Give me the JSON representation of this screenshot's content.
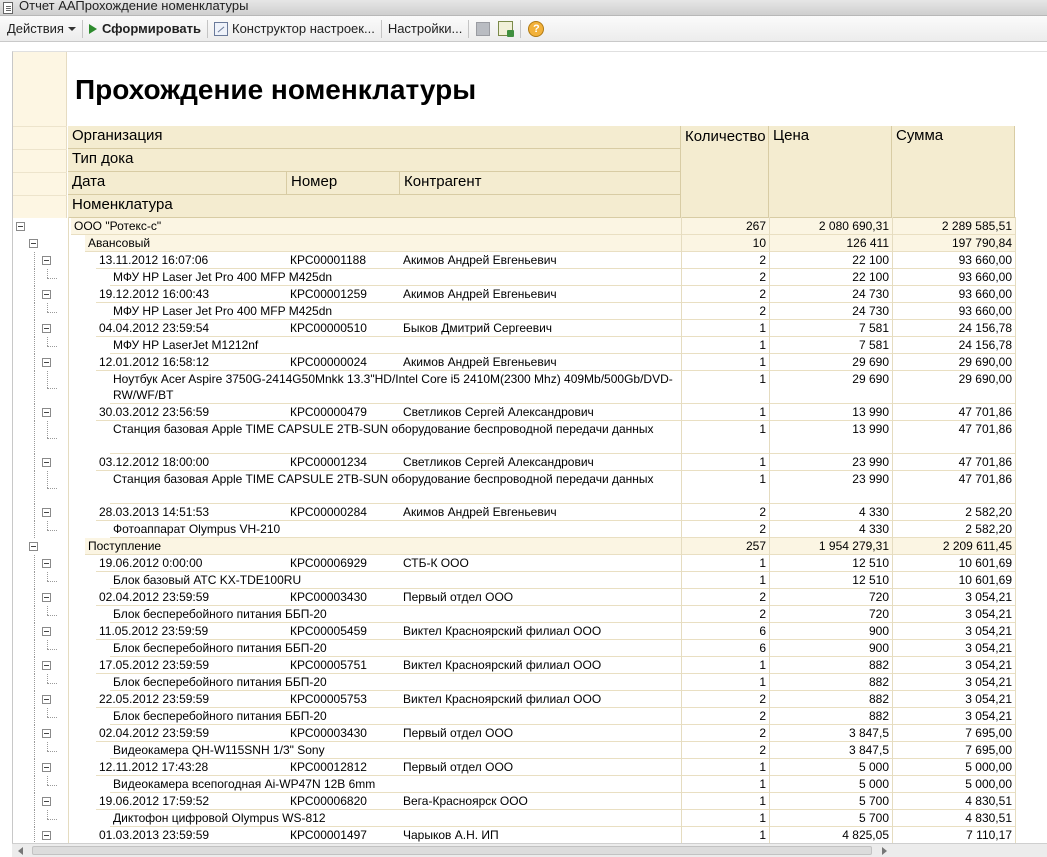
{
  "window": {
    "title": "Отчет  ААПрохождение номенклатуры"
  },
  "toolbar": {
    "actions_label": "Действия",
    "generate_label": "Сформировать",
    "constructor_label": "Конструктор настроек...",
    "settings_label": "Настройки...",
    "help_label": "?"
  },
  "report": {
    "title": "Прохождение номенклатуры",
    "headers": {
      "org": "Организация",
      "doc_type": "Тип дока",
      "date": "Дата",
      "number": "Номер",
      "counterparty": "Контрагент",
      "nomenclature": "Номенклатура",
      "quantity": "Количество",
      "price": "Цена",
      "sum": "Сумма"
    },
    "rows": [
      {
        "level": 0,
        "kind": "group",
        "text": "ООО \"Ротекс-с\"",
        "qty": "267",
        "price": "2 080 690,31",
        "sum": "2 289 585,51"
      },
      {
        "level": 1,
        "kind": "group",
        "text": "Авансовый",
        "qty": "10",
        "price": "126 411",
        "sum": "197 790,84"
      },
      {
        "level": 2,
        "kind": "doc",
        "date": "13.11.2012 16:07:06",
        "number": "КРС00001188",
        "counterparty": "Акимов Андрей Евгеньевич",
        "qty": "2",
        "price": "22 100",
        "sum": "93 660,00"
      },
      {
        "level": 3,
        "kind": "item",
        "text": "МФУ HP Laser Jet Pro 400 MFP M425dn",
        "qty": "2",
        "price": "22 100",
        "sum": "93 660,00"
      },
      {
        "level": 2,
        "kind": "doc",
        "date": "19.12.2012 16:00:43",
        "number": "КРС00001259",
        "counterparty": "Акимов Андрей Евгеньевич",
        "qty": "2",
        "price": "24 730",
        "sum": "93 660,00"
      },
      {
        "level": 3,
        "kind": "item",
        "text": "МФУ HP Laser Jet Pro 400 MFP M425dn",
        "qty": "2",
        "price": "24 730",
        "sum": "93 660,00"
      },
      {
        "level": 2,
        "kind": "doc",
        "date": "04.04.2012 23:59:54",
        "number": "КРС00000510",
        "counterparty": "Быков Дмитрий Сергеевич",
        "qty": "1",
        "price": "7 581",
        "sum": "24 156,78"
      },
      {
        "level": 3,
        "kind": "item",
        "text": "МФУ HP LaserJet M1212nf",
        "qty": "1",
        "price": "7 581",
        "sum": "24 156,78"
      },
      {
        "level": 2,
        "kind": "doc",
        "date": "12.01.2012 16:58:12",
        "number": "КРС00000024",
        "counterparty": "Акимов Андрей Евгеньевич",
        "qty": "1",
        "price": "29 690",
        "sum": "29 690,00"
      },
      {
        "level": 3,
        "kind": "item",
        "text": "Ноутбук Acer Aspire 3750G-2414G50Mnkk 13.3\"HD/Intel Core i5 2410M(2300 Mhz) 409Mb/500Gb/DVD-RW/WF/BT",
        "qty": "1",
        "price": "29 690",
        "sum": "29 690,00",
        "tall": true
      },
      {
        "level": 2,
        "kind": "doc",
        "date": "30.03.2012 23:56:59",
        "number": "КРС00000479",
        "counterparty": "Светликов Сергей Александрович",
        "qty": "1",
        "price": "13 990",
        "sum": "47 701,86"
      },
      {
        "level": 3,
        "kind": "item",
        "text": "Станция базовая Apple TIME CAPSULE 2TB-SUN оборудование беспроводной передачи данных",
        "qty": "1",
        "price": "13 990",
        "sum": "47 701,86",
        "tall": true
      },
      {
        "level": 2,
        "kind": "doc",
        "date": "03.12.2012 18:00:00",
        "number": "КРС00001234",
        "counterparty": "Светликов Сергей Александрович",
        "qty": "1",
        "price": "23 990",
        "sum": "47 701,86"
      },
      {
        "level": 3,
        "kind": "item",
        "text": "Станция базовая Apple TIME CAPSULE 2TB-SUN оборудование беспроводной передачи данных",
        "qty": "1",
        "price": "23 990",
        "sum": "47 701,86",
        "tall": true
      },
      {
        "level": 2,
        "kind": "doc",
        "date": "28.03.2013 14:51:53",
        "number": "КРС00000284",
        "counterparty": "Акимов Андрей Евгеньевич",
        "qty": "2",
        "price": "4 330",
        "sum": "2 582,20"
      },
      {
        "level": 3,
        "kind": "item",
        "text": "Фотоаппарат Olympus VH-210",
        "qty": "2",
        "price": "4 330",
        "sum": "2 582,20"
      },
      {
        "level": 1,
        "kind": "group",
        "text": "Поступление",
        "qty": "257",
        "price": "1 954 279,31",
        "sum": "2 209 611,45"
      },
      {
        "level": 2,
        "kind": "doc",
        "date": "19.06.2012 0:00:00",
        "number": "КРС00006929",
        "counterparty": "СТБ-К ООО",
        "qty": "1",
        "price": "12 510",
        "sum": "10 601,69"
      },
      {
        "level": 3,
        "kind": "item",
        "text": "Блок базовый АТС KX-TDE100RU",
        "qty": "1",
        "price": "12 510",
        "sum": "10 601,69"
      },
      {
        "level": 2,
        "kind": "doc",
        "date": "02.04.2012 23:59:59",
        "number": "КРС00003430",
        "counterparty": "Первый отдел ООО",
        "qty": "2",
        "price": "720",
        "sum": "3 054,21"
      },
      {
        "level": 3,
        "kind": "item",
        "text": "Блок бесперебойного питания ББП-20",
        "qty": "2",
        "price": "720",
        "sum": "3 054,21"
      },
      {
        "level": 2,
        "kind": "doc",
        "date": "11.05.2012 23:59:59",
        "number": "КРС00005459",
        "counterparty": "Виктел Красноярский филиал ООО",
        "qty": "6",
        "price": "900",
        "sum": "3 054,21"
      },
      {
        "level": 3,
        "kind": "item",
        "text": "Блок бесперебойного питания ББП-20",
        "qty": "6",
        "price": "900",
        "sum": "3 054,21"
      },
      {
        "level": 2,
        "kind": "doc",
        "date": "17.05.2012 23:59:59",
        "number": "КРС00005751",
        "counterparty": "Виктел Красноярский филиал ООО",
        "qty": "1",
        "price": "882",
        "sum": "3 054,21"
      },
      {
        "level": 3,
        "kind": "item",
        "text": "Блок бесперебойного питания ББП-20",
        "qty": "1",
        "price": "882",
        "sum": "3 054,21"
      },
      {
        "level": 2,
        "kind": "doc",
        "date": "22.05.2012 23:59:59",
        "number": "КРС00005753",
        "counterparty": "Виктел Красноярский филиал ООО",
        "qty": "2",
        "price": "882",
        "sum": "3 054,21"
      },
      {
        "level": 3,
        "kind": "item",
        "text": "Блок бесперебойного питания ББП-20",
        "qty": "2",
        "price": "882",
        "sum": "3 054,21"
      },
      {
        "level": 2,
        "kind": "doc",
        "date": "02.04.2012 23:59:59",
        "number": "КРС00003430",
        "counterparty": "Первый отдел ООО",
        "qty": "2",
        "price": "3 847,5",
        "sum": "7 695,00"
      },
      {
        "level": 3,
        "kind": "item",
        "text": "Видеокамера QH-W115SNH 1/3\" Sony",
        "qty": "2",
        "price": "3 847,5",
        "sum": "7 695,00"
      },
      {
        "level": 2,
        "kind": "doc",
        "date": "12.11.2012 17:43:28",
        "number": "КРС00012812",
        "counterparty": "Первый отдел ООО",
        "qty": "1",
        "price": "5 000",
        "sum": "5 000,00"
      },
      {
        "level": 3,
        "kind": "item",
        "text": "Видеокамера всепогодная Ai-WP47N 12В 6mm",
        "qty": "1",
        "price": "5 000",
        "sum": "5 000,00"
      },
      {
        "level": 2,
        "kind": "doc",
        "date": "19.06.2012 17:59:52",
        "number": "КРС00006820",
        "counterparty": "Вега-Красноярск ООО",
        "qty": "1",
        "price": "5 700",
        "sum": "4 830,51"
      },
      {
        "level": 3,
        "kind": "item",
        "text": "Диктофон цифровой Olympus WS-812",
        "qty": "1",
        "price": "5 700",
        "sum": "4 830,51"
      },
      {
        "level": 2,
        "kind": "doc",
        "date": "01.03.2013 23:59:59",
        "number": "КРС00001497",
        "counterparty": "Чарыков А.Н. ИП",
        "qty": "1",
        "price": "4 825,05",
        "sum": "7 110,17"
      }
    ]
  }
}
